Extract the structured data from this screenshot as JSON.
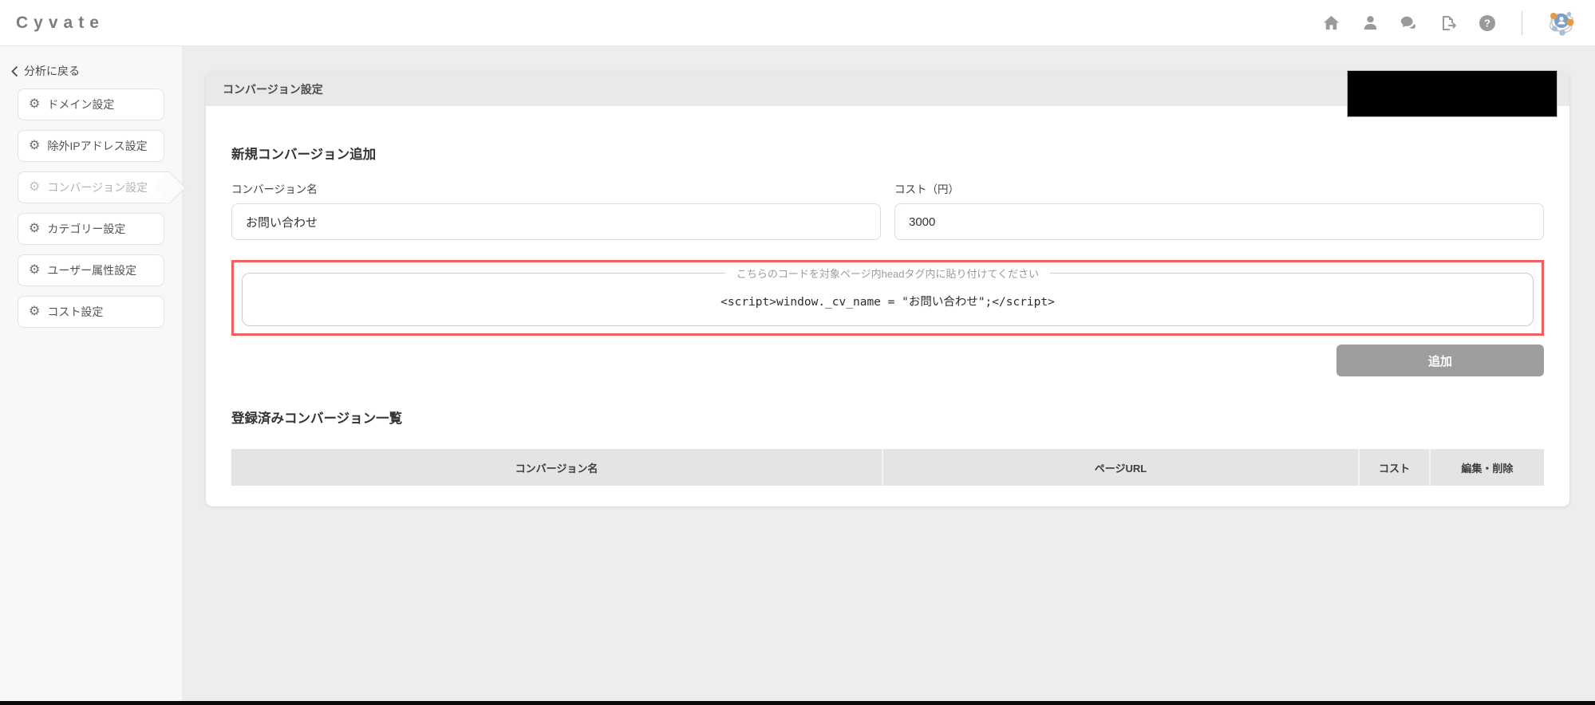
{
  "app": {
    "brand": "Cyvate"
  },
  "topbar": {
    "icon_names": [
      "home-icon",
      "user-icon",
      "chat-icon",
      "export-icon",
      "help-icon",
      "brand-network-icon"
    ]
  },
  "sidebar": {
    "back_label": "分析に戻る",
    "items": [
      {
        "label": "ドメイン設定",
        "active": false
      },
      {
        "label": "除外IPアドレス設定",
        "active": false
      },
      {
        "label": "コンバージョン設定",
        "active": true
      },
      {
        "label": "カテゴリー設定",
        "active": false
      },
      {
        "label": "ユーザー属性設定",
        "active": false
      },
      {
        "label": "コスト設定",
        "active": false
      }
    ]
  },
  "main": {
    "card_title": "コンバージョン設定",
    "new_conversion": {
      "heading": "新規コンバージョン追加",
      "name_label": "コンバージョン名",
      "name_value": "お問い合わせ",
      "cost_label": "コスト（円）",
      "cost_value": "3000",
      "snippet_legend": "こちらのコードを対象ページ内headタグ内に貼り付けてください",
      "snippet_code": "<script>window._cv_name = \"お問い合わせ\";</script>",
      "add_button_label": "追加"
    },
    "registered_list": {
      "heading": "登録済みコンバージョン一覧",
      "columns": [
        "コンバージョン名",
        "ページURL",
        "コスト",
        "編集・削除"
      ],
      "rows": []
    }
  },
  "colors": {
    "alert_border": "#f15f5f",
    "add_button_bg": "#9d9d9d",
    "card_header_bg": "#e9e9e9",
    "table_header_bg": "#e4e4e4",
    "brand_orange": "#e79b3f",
    "brand_blue": "#7b9ec9"
  }
}
